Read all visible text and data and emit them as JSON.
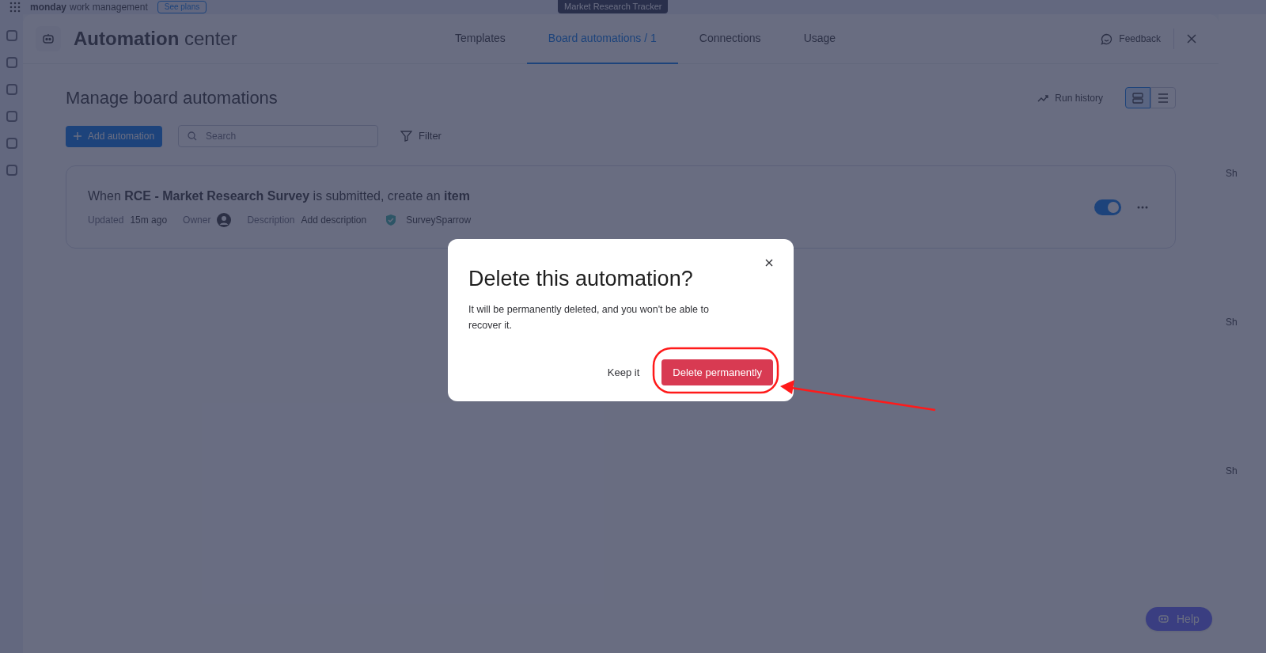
{
  "topbar": {
    "logo": "monday",
    "product": "work management",
    "plans_button": "See plans",
    "board_title": "Market Research Tracker"
  },
  "background_cells": [
    "Sh",
    "Sh",
    "Sh"
  ],
  "panel": {
    "title": "**Automation** center",
    "tabs": [
      {
        "label": "Templates",
        "selected": false
      },
      {
        "label": "Board automations / 1",
        "selected": true
      },
      {
        "label": "Connections",
        "selected": false
      },
      {
        "label": "Usage",
        "selected": false
      }
    ],
    "feedback": "Feedback",
    "heading": "Manage board automations",
    "run_history": "Run history",
    "views": [
      {
        "kind": "cards",
        "selected": true
      },
      {
        "kind": "list",
        "selected": false
      }
    ],
    "add_button": "Add automation",
    "search": {
      "placeholder": "Search"
    },
    "filter": "Filter",
    "automations": [
      {
        "sentence": "When **RCE - Market Research Survey** is submitted, create an **item**",
        "updated_label": "Updated",
        "updated_value": "15m ago",
        "owner_label": "Owner",
        "description_label": "Description",
        "description_value": "Add description",
        "integration": "SurveySparrow",
        "on": true
      }
    ],
    "help": "Help"
  },
  "dialog": {
    "title": "Delete this automation?",
    "message": "It will be permanently deleted, and you won't be able to recover it.",
    "secondary_button": "Keep it",
    "primary_button": "Delete permanently"
  }
}
